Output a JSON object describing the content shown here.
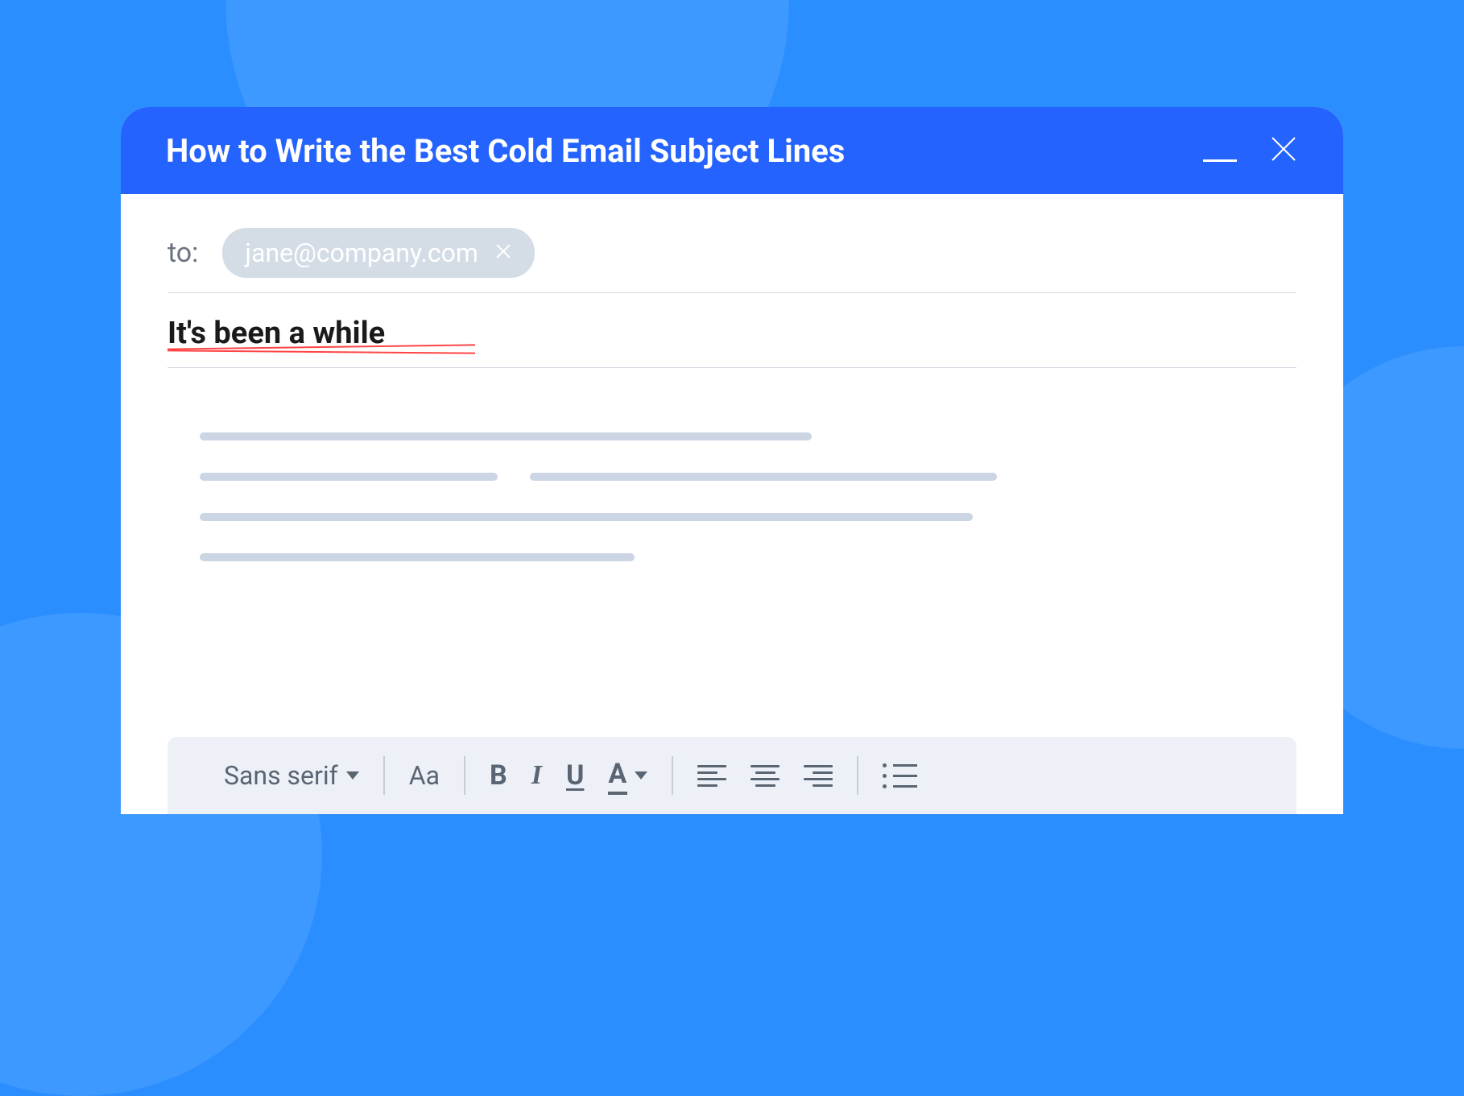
{
  "window": {
    "title": "How to Write the Best Cold Email Subject Lines"
  },
  "compose": {
    "to_label": "to:",
    "recipient": "jane@company.com",
    "subject": "It's been a while"
  },
  "toolbar": {
    "font_family": "Sans serif",
    "font_size_label": "Aa",
    "bold_label": "B",
    "italic_label": "I",
    "underline_label": "U",
    "text_color_label": "A"
  }
}
